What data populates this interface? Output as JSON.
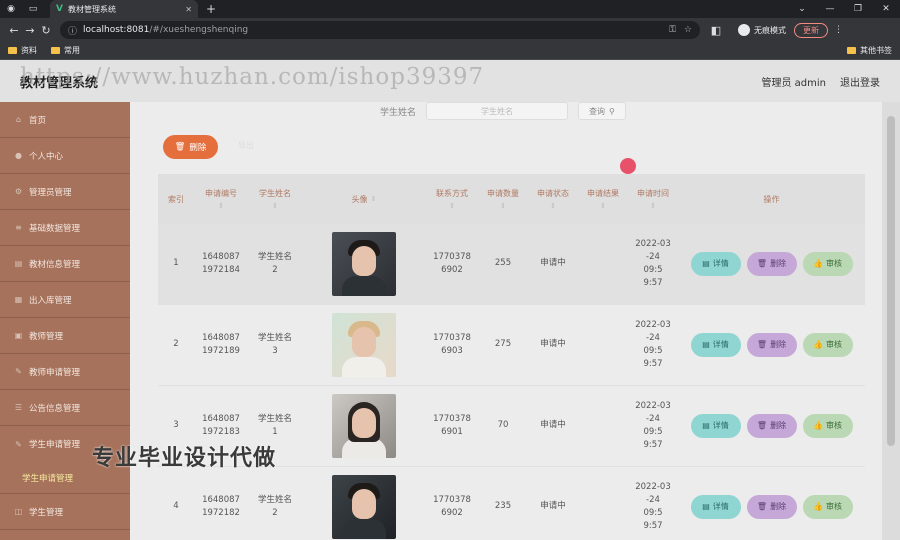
{
  "browser": {
    "tab_title": "教材管理系统",
    "url_host": "localhost:8081",
    "url_path": "/#/xueshengshenqing",
    "incognito_label": "无痕模式",
    "update_label": "更新",
    "bookmarks": [
      "资料",
      "常用"
    ],
    "other_bookmarks": "其他书签"
  },
  "header": {
    "title": "教材管理系统",
    "watermark": "https://www.huzhan.com/ishop39397",
    "user": "管理员 admin",
    "logout": "退出登录"
  },
  "sidebar": {
    "items": [
      {
        "label": "首页",
        "icon": "home-icon"
      },
      {
        "label": "个人中心",
        "icon": "user-icon"
      },
      {
        "label": "管理员管理",
        "icon": "admin-icon"
      },
      {
        "label": "基础数据管理",
        "icon": "database-icon"
      },
      {
        "label": "教材信息管理",
        "icon": "book-icon"
      },
      {
        "label": "出入库管理",
        "icon": "warehouse-icon"
      },
      {
        "label": "教师管理",
        "icon": "teacher-icon"
      },
      {
        "label": "教师申请管理",
        "icon": "apply-icon"
      },
      {
        "label": "公告信息管理",
        "icon": "notice-icon"
      },
      {
        "label": "学生申请管理",
        "icon": "apply-icon"
      }
    ],
    "submenu": "学生申请管理",
    "last_item": {
      "label": "学生管理",
      "icon": "student-icon"
    }
  },
  "search": {
    "label": "学生姓名",
    "placeholder": "学生姓名",
    "button": "查询"
  },
  "toolbar": {
    "delete_label": "删除",
    "ghost": "导出"
  },
  "table": {
    "columns": [
      "索引",
      "申请编号",
      "学生姓名",
      "头像",
      "联系方式",
      "申请数量",
      "申请状态",
      "申请结果",
      "申请时间",
      "操作"
    ],
    "rows": [
      {
        "index": "1",
        "no": "1648087 1972184",
        "name": "学生姓名 2",
        "phone": "1770378 6902",
        "qty": "255",
        "state": "申请中",
        "result": "",
        "time": "2022-03 -24 09:5 9:57",
        "photo": "ph-1"
      },
      {
        "index": "2",
        "no": "1648087 1972189",
        "name": "学生姓名 3",
        "phone": "1770378 6903",
        "qty": "275",
        "state": "申请中",
        "result": "",
        "time": "2022-03 -24 09:5 9:57",
        "photo": "ph-2"
      },
      {
        "index": "3",
        "no": "1648087 1972183",
        "name": "学生姓名 1",
        "phone": "1770378 6901",
        "qty": "70",
        "state": "申请中",
        "result": "",
        "time": "2022-03 -24 09:5 9:57",
        "photo": "ph-3"
      },
      {
        "index": "4",
        "no": "1648087 1972182",
        "name": "学生姓名 2",
        "phone": "1770378 6902",
        "qty": "235",
        "state": "申请中",
        "result": "",
        "time": "2022-03 -24 09:5 9:57",
        "photo": "ph-4"
      }
    ],
    "actions": {
      "detail": "详情",
      "delete": "删除",
      "audit": "审核"
    }
  },
  "overlay": "专业毕业设计代做"
}
